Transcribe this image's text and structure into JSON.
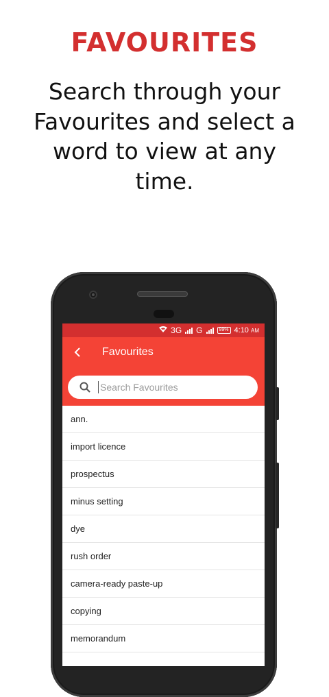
{
  "promo": {
    "title": "FAVOURITES",
    "description": "Search through your Favourites and select a word to view at any time."
  },
  "colors": {
    "accent": "#d32f2f",
    "toolbar": "#f44336",
    "status_bar": "#d32f2f"
  },
  "status_bar": {
    "network1": "3G",
    "network2": "G",
    "battery": "99%",
    "time": "4:10",
    "ampm": "AM"
  },
  "toolbar": {
    "back_icon": "chevron-left-icon",
    "title": "Favourites"
  },
  "search": {
    "icon": "search-icon",
    "placeholder": "Search Favourites",
    "value": ""
  },
  "favourites": [
    "ann.",
    "import licence",
    "prospectus",
    "minus setting",
    "dye",
    "rush order",
    "camera-ready paste-up",
    "copying",
    "memorandum"
  ]
}
